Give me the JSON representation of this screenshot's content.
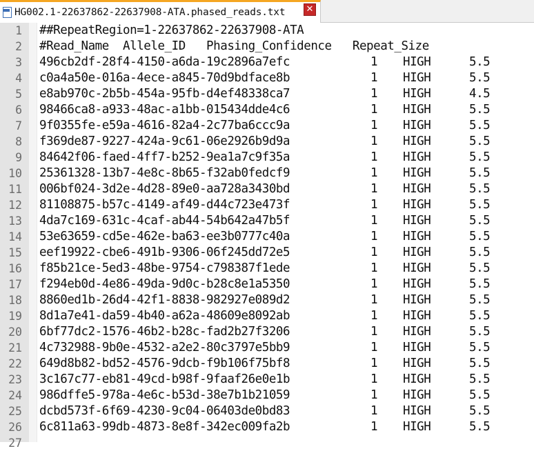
{
  "tab": {
    "title": "HG002.1-22637862-22637908-ATA.phased_reads.txt",
    "close_symbol": "✕",
    "accent": "#f5a623",
    "close_color": "#c62828"
  },
  "lines": [
    {
      "n": "1",
      "text": "##RepeatRegion=1-22637862-22637908-ATA"
    },
    {
      "n": "2",
      "text": "#Read_Name  Allele_ID   Phasing_Confidence   Repeat_Size"
    },
    {
      "n": "3",
      "id": "496cb2df-28f4-4150-a6da-19c2896a7efc",
      "allele": "1",
      "conf": "HIGH",
      "size": "5.5"
    },
    {
      "n": "4",
      "id": "c0a4a50e-016a-4ece-a845-70d9bdface8b",
      "allele": "1",
      "conf": "HIGH",
      "size": "5.5"
    },
    {
      "n": "5",
      "id": "e8ab970c-2b5b-454a-95fb-d4ef48338ca7",
      "allele": "1",
      "conf": "HIGH",
      "size": "4.5"
    },
    {
      "n": "6",
      "id": "98466ca8-a933-48ac-a1bb-015434dde4c6",
      "allele": "1",
      "conf": "HIGH",
      "size": "5.5"
    },
    {
      "n": "7",
      "id": "9f0355fe-e59a-4616-82a4-2c77ba6ccc9a",
      "allele": "1",
      "conf": "HIGH",
      "size": "5.5"
    },
    {
      "n": "8",
      "id": "f369de87-9227-424a-9c61-06e2926b9d9a",
      "allele": "1",
      "conf": "HIGH",
      "size": "5.5"
    },
    {
      "n": "9",
      "id": "84642f06-faed-4ff7-b252-9ea1a7c9f35a",
      "allele": "1",
      "conf": "HIGH",
      "size": "5.5"
    },
    {
      "n": "10",
      "id": "25361328-13b7-4e8c-8b65-f32ab0fedcf9",
      "allele": "1",
      "conf": "HIGH",
      "size": "5.5"
    },
    {
      "n": "11",
      "id": "006bf024-3d2e-4d28-89e0-aa728a3430bd",
      "allele": "1",
      "conf": "HIGH",
      "size": "5.5"
    },
    {
      "n": "12",
      "id": "81108875-b57c-4149-af49-d44c723e473f",
      "allele": "1",
      "conf": "HIGH",
      "size": "5.5"
    },
    {
      "n": "13",
      "id": "4da7c169-631c-4caf-ab44-54b642a47b5f",
      "allele": "1",
      "conf": "HIGH",
      "size": "5.5"
    },
    {
      "n": "14",
      "id": "53e63659-cd5e-462e-ba63-ee3b0777c40a",
      "allele": "1",
      "conf": "HIGH",
      "size": "5.5"
    },
    {
      "n": "15",
      "id": "eef19922-cbe6-491b-9306-06f245dd72e5",
      "allele": "1",
      "conf": "HIGH",
      "size": "5.5"
    },
    {
      "n": "16",
      "id": "f85b21ce-5ed3-48be-9754-c798387f1ede",
      "allele": "1",
      "conf": "HIGH",
      "size": "5.5"
    },
    {
      "n": "17",
      "id": "f294eb0d-4e86-49da-9d0c-b28c8e1a5350",
      "allele": "1",
      "conf": "HIGH",
      "size": "5.5"
    },
    {
      "n": "18",
      "id": "8860ed1b-26d4-42f1-8838-982927e089d2",
      "allele": "1",
      "conf": "HIGH",
      "size": "5.5"
    },
    {
      "n": "19",
      "id": "8d1a7e41-da59-4b40-a62a-48609e8092ab",
      "allele": "1",
      "conf": "HIGH",
      "size": "5.5"
    },
    {
      "n": "20",
      "id": "6bf77dc2-1576-46b2-b28c-fad2b27f3206",
      "allele": "1",
      "conf": "HIGH",
      "size": "5.5"
    },
    {
      "n": "21",
      "id": "4c732988-9b0e-4532-a2e2-80c3797e5bb9",
      "allele": "1",
      "conf": "HIGH",
      "size": "5.5"
    },
    {
      "n": "22",
      "id": "649d8b82-bd52-4576-9dcb-f9b106f75bf8",
      "allele": "1",
      "conf": "HIGH",
      "size": "5.5"
    },
    {
      "n": "23",
      "id": "3c167c77-eb81-49cd-b98f-9faaf26e0e1b",
      "allele": "1",
      "conf": "HIGH",
      "size": "5.5"
    },
    {
      "n": "24",
      "id": "986dffe5-978a-4e6c-b53d-38e7b1b21059",
      "allele": "1",
      "conf": "HIGH",
      "size": "5.5"
    },
    {
      "n": "25",
      "id": "dcbd573f-6f69-4230-9c04-06403de0bd83",
      "allele": "1",
      "conf": "HIGH",
      "size": "5.5"
    },
    {
      "n": "26",
      "id": "6c811a63-99db-4873-8e8f-342ec009fa2b",
      "allele": "1",
      "conf": "HIGH",
      "size": "5.5"
    },
    {
      "n": "27",
      "id": "",
      "allele": "",
      "conf": "",
      "size": ""
    }
  ]
}
